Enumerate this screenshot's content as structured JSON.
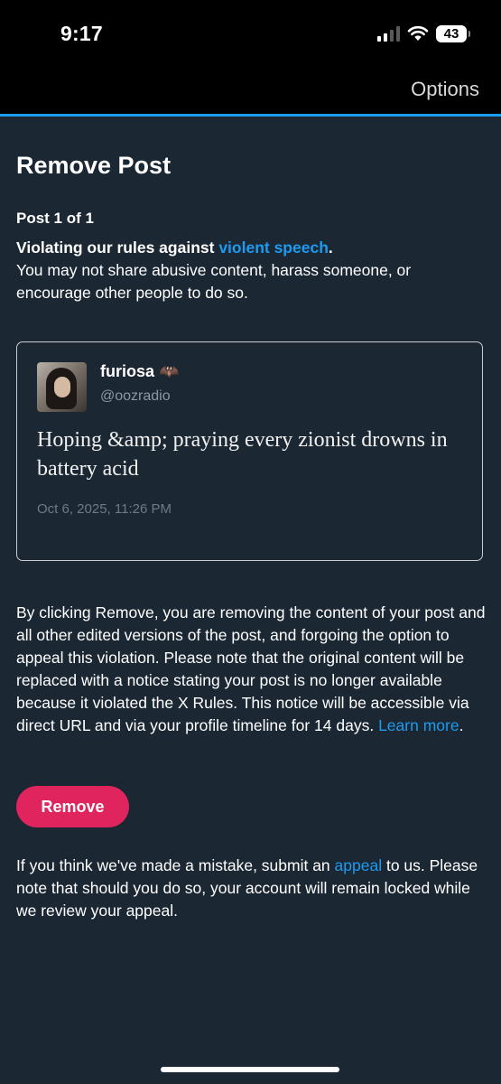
{
  "status_bar": {
    "time": "9:17",
    "battery": "43",
    "icons": [
      "cellular-signal-icon",
      "wifi-icon",
      "battery-icon"
    ]
  },
  "nav": {
    "options_label": "Options"
  },
  "page": {
    "title": "Remove Post",
    "post_count": "Post 1 of 1",
    "rule_prefix": "Violating our rules against ",
    "rule_link": "violent speech",
    "rule_suffix": ".",
    "rule_description": "You may not share abusive content, harass someone, or encourage other people to do so."
  },
  "post": {
    "display_name": "furiosa",
    "name_emoji": "🦇",
    "handle": "@oozradio",
    "text": "Hoping &amp; praying every zionist drowns in battery acid",
    "timestamp": "Oct 6, 2025, 11:26 PM"
  },
  "notice": {
    "text": "By clicking Remove, you are removing the content of your post and all other edited versions of the post, and forgoing the option to appeal this violation. Please note that the original content will be replaced with a notice stating your post is no longer available because it violated the X Rules. This notice will be accessible via direct URL and via your profile timeline for 14 days.",
    "learn_more": "Learn more",
    "learn_more_suffix": "."
  },
  "actions": {
    "remove_label": "Remove"
  },
  "appeal": {
    "prefix": "If you think we've made a mistake, submit an ",
    "link": "appeal",
    "suffix": " to us. Please note that should you do so, your account will remain locked while we review your appeal."
  },
  "colors": {
    "background": "#1b2733",
    "accent": "#1d9bf0",
    "remove_button": "#e0245e",
    "nav_background": "#000000"
  }
}
